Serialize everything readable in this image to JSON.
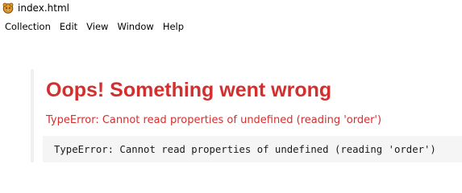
{
  "window": {
    "title": "index.html",
    "icon": "app-logo-icon"
  },
  "menubar": {
    "items": [
      "Collection",
      "Edit",
      "View",
      "Window",
      "Help"
    ]
  },
  "error": {
    "heading": "Oops! Something went wrong",
    "message": "TypeError: Cannot read properties of undefined (reading 'order')",
    "stack": "TypeError: Cannot read properties of undefined (reading 'order')"
  },
  "colors": {
    "error_red": "#d32f2f",
    "stack_background": "#f5f5f5",
    "content_border": "#f0f0f0"
  }
}
